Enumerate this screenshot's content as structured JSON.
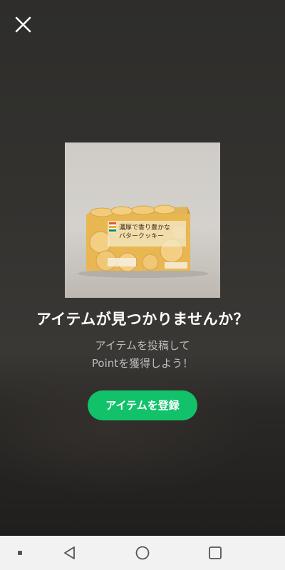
{
  "header": {
    "close_icon": "close-icon"
  },
  "product_image": {
    "package_text_line1": "濃厚で香り豊かな",
    "package_text_line2": "バタークッキー"
  },
  "empty_state": {
    "headline": "アイテムが見つかりませんか？",
    "sub_line1": "アイテムを投稿して",
    "sub_line2": "Pointを獲得しよう！",
    "button_label": "アイテムを登録"
  },
  "colors": {
    "accent": "#11c26b",
    "background": "#2e2d2b",
    "nav_bar": "#f2f2f2"
  },
  "nav_bar": {
    "items": [
      "menu-dot-icon",
      "back-icon",
      "home-icon",
      "recents-icon"
    ]
  }
}
